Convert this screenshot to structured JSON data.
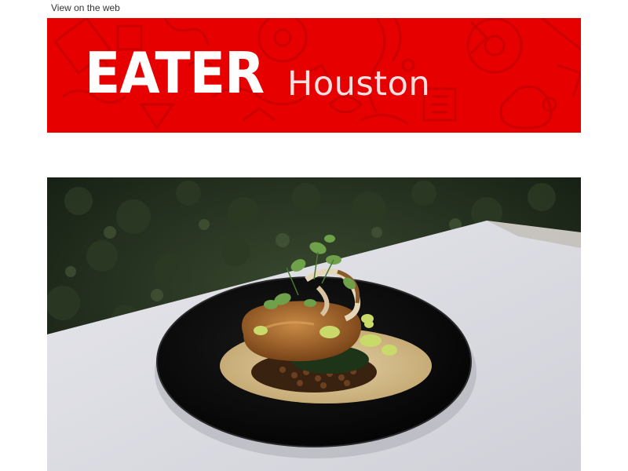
{
  "header": {
    "view_on_web": "View on the web"
  },
  "banner": {
    "brand": "EATER",
    "city": "Houston",
    "background_color": "#e60000"
  },
  "hero": {
    "image": "plated-chicken-dish-photo"
  }
}
